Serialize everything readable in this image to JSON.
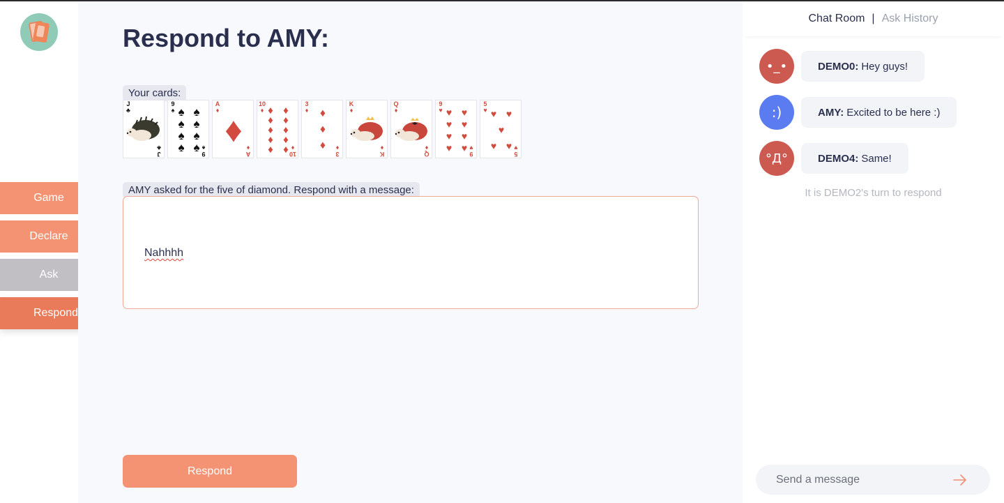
{
  "sidebar": {
    "logo": "card-deck-logo",
    "nav": {
      "game": "Game",
      "declare": "Declare",
      "ask": "Ask",
      "respond": "Respond"
    }
  },
  "main": {
    "title": "Respond to AMY:",
    "cards_label": "Your cards:",
    "cards": [
      {
        "rank": "J",
        "suit": "♣",
        "color": "black"
      },
      {
        "rank": "9",
        "suit": "♠",
        "color": "black"
      },
      {
        "rank": "A",
        "suit": "♦",
        "color": "red"
      },
      {
        "rank": "10",
        "suit": "♦",
        "color": "red"
      },
      {
        "rank": "3",
        "suit": "♦",
        "color": "red"
      },
      {
        "rank": "K",
        "suit": "♦",
        "color": "red"
      },
      {
        "rank": "Q",
        "suit": "♦",
        "color": "red"
      },
      {
        "rank": "9",
        "suit": "♥",
        "color": "red"
      },
      {
        "rank": "5",
        "suit": "♥",
        "color": "red"
      }
    ],
    "ask_label": "AMY asked for the five of diamond. Respond with a message:",
    "message_value": "Nahhhh",
    "respond_button": "Respond"
  },
  "chat": {
    "tab_active": "Chat Room",
    "tab_separator": "|",
    "tab_inactive": "Ask History",
    "messages": [
      {
        "avatar": "•_•",
        "avatar_color": "#cd5a50",
        "sender": "DEMO0:",
        "text": "Hey guys!"
      },
      {
        "avatar": ":)",
        "avatar_color": "#5b7cf0",
        "sender": "AMY:",
        "text": "Excited to be here :)"
      },
      {
        "avatar": "°Д°",
        "avatar_color": "#cd5a50",
        "sender": "DEMO4:",
        "text": "Same!"
      }
    ],
    "status": "It is DEMO2's turn to respond",
    "input_placeholder": "Send a message",
    "send_icon": "arrow-right-icon"
  },
  "colors": {
    "accent": "#f39374",
    "accent_active": "#e97a5a",
    "ask_disabled": "#c1bec4",
    "title": "#2a2f4e"
  }
}
